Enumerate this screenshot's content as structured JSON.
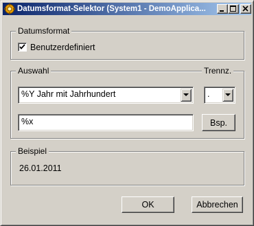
{
  "window": {
    "title": "Datumsformat-Selektor (System1 - DemoApplica..."
  },
  "groups": {
    "datumsformat": {
      "label": "Datumsformat",
      "checkbox_label": "Benutzerdefiniert",
      "checked": true
    },
    "auswahl": {
      "label": "Auswahl",
      "trennz_label": "Trennz.",
      "format_select_value": "%Y Jahr mit Jahrhundert",
      "separator_select_value": ".",
      "format_input_value": "%x",
      "example_button_label": "Bsp."
    },
    "beispiel": {
      "label": "Beispiel",
      "value": "26.01.2011"
    }
  },
  "buttons": {
    "ok": "OK",
    "cancel": "Abbrechen"
  },
  "colors": {
    "face": "#d4d0c8",
    "title_start": "#0a246a",
    "title_end": "#a6caf0"
  }
}
